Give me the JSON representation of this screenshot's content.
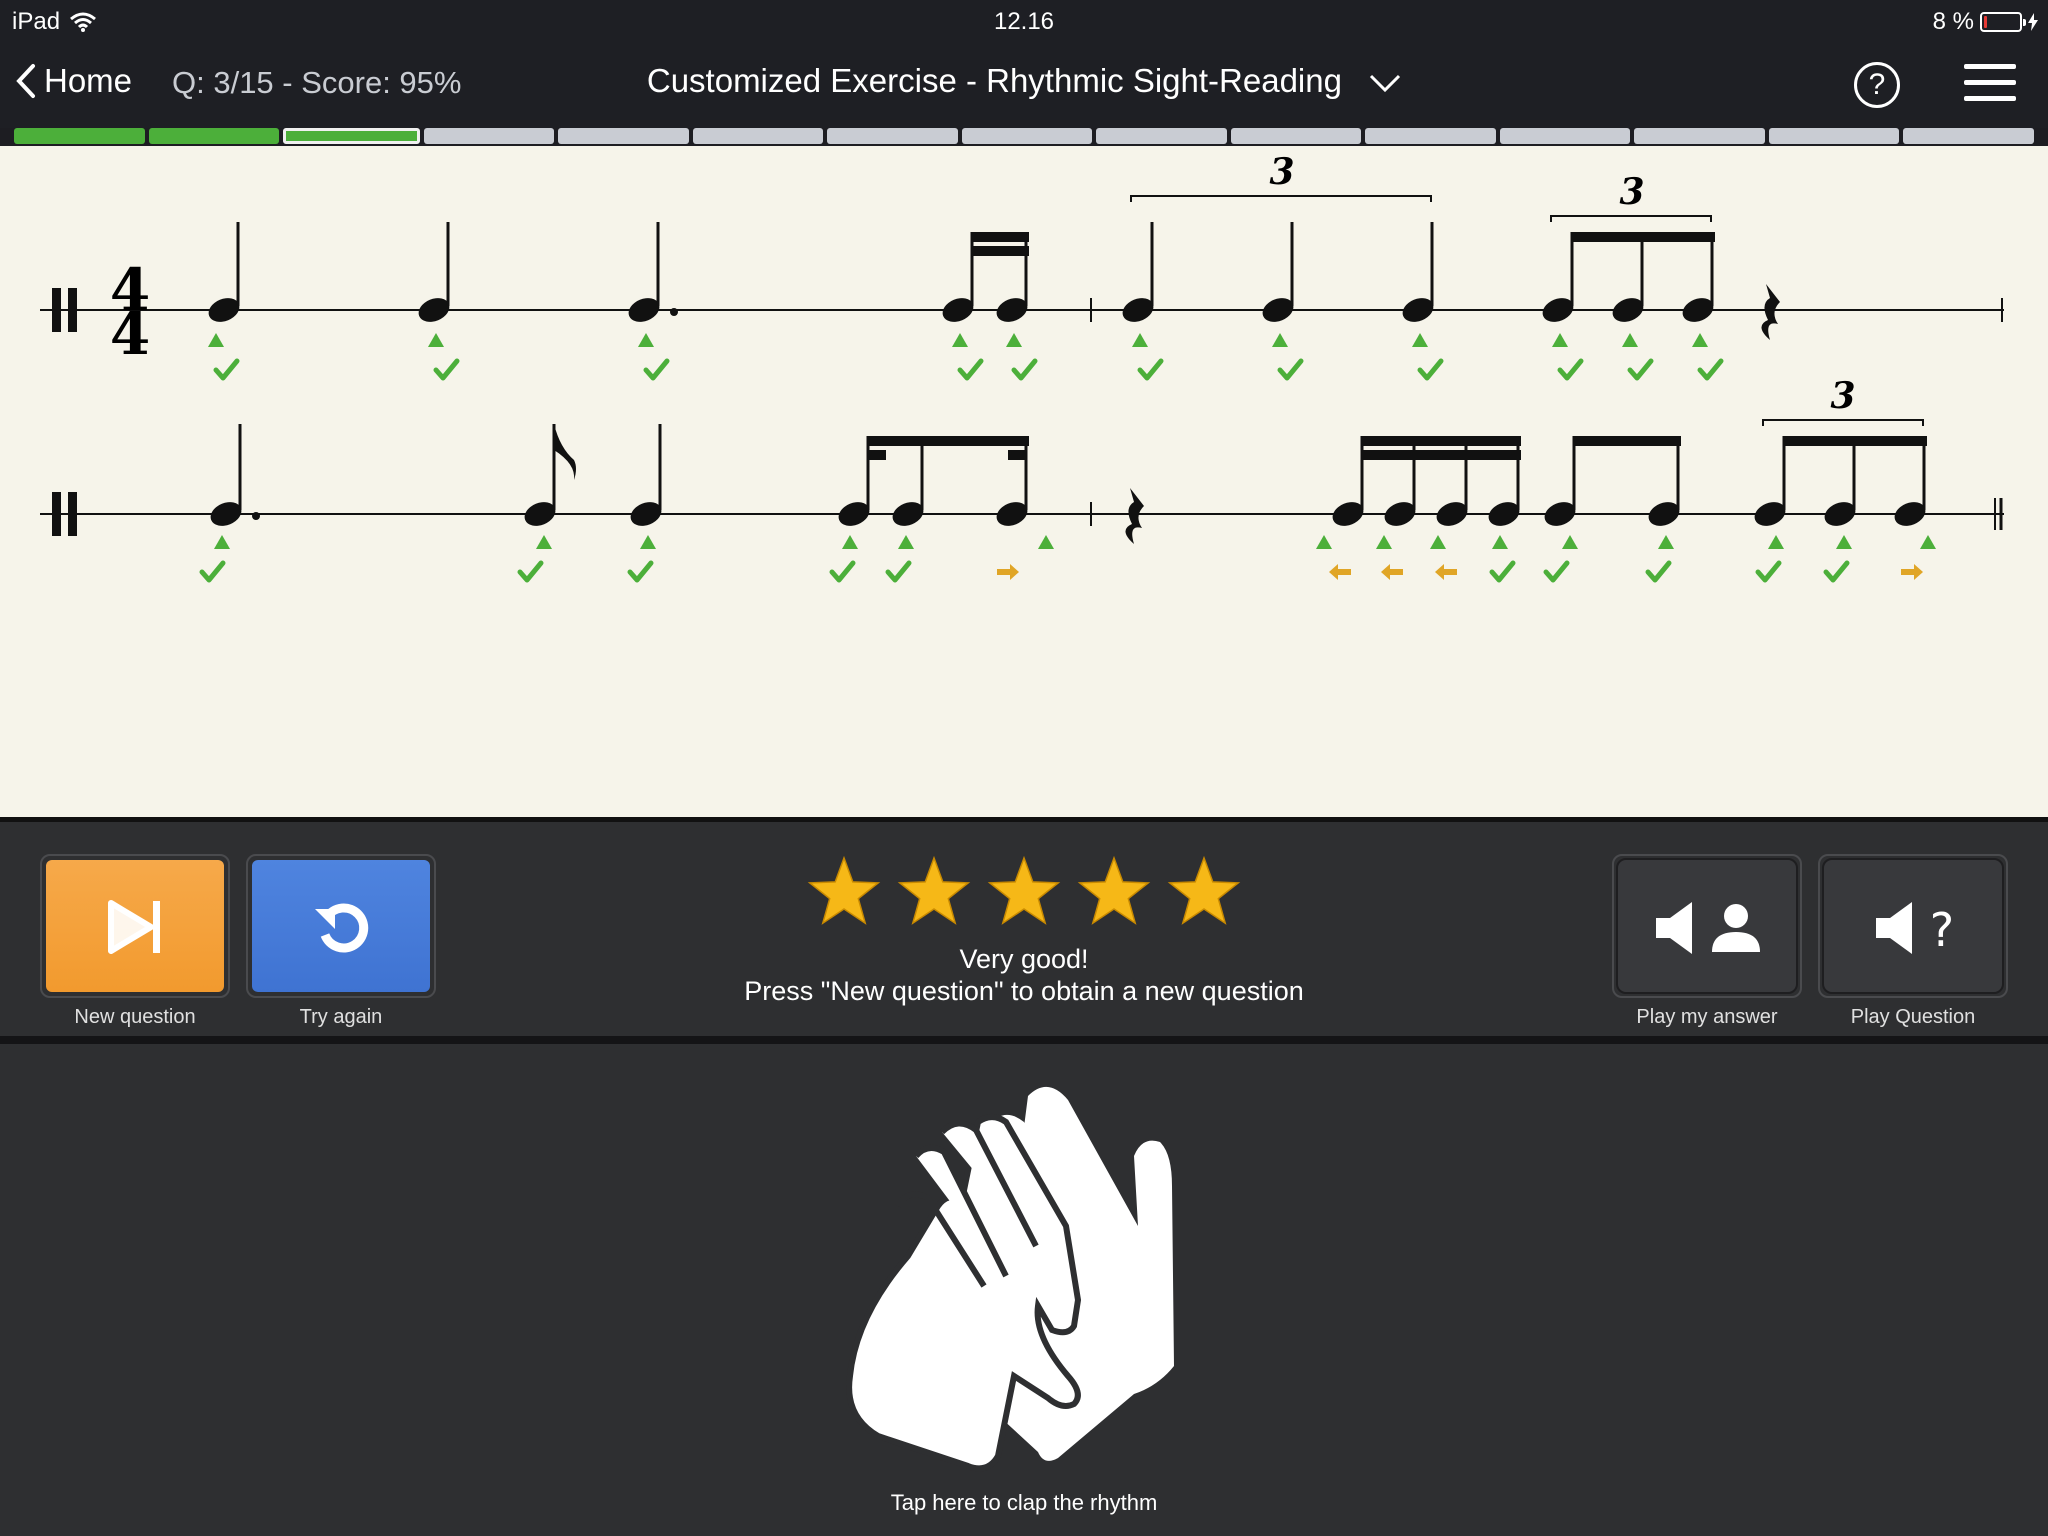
{
  "status": {
    "device": "iPad",
    "time": "12.16",
    "battery_text": "8 %",
    "battery_level": 0.08
  },
  "nav": {
    "back_label": "Home",
    "qscore": "Q: 3/15 - Score: 95%",
    "title": "Customized Exercise - Rhythmic Sight-Reading"
  },
  "progress": {
    "total": 15,
    "completed": 2,
    "current": 3
  },
  "score": {
    "time_signature_top": "4",
    "time_signature_bottom": "4",
    "tuplet_labels": [
      "3",
      "3",
      "3"
    ]
  },
  "controls": {
    "new_question_label": "New question",
    "try_again_label": "Try again",
    "play_answer_label": "Play my answer",
    "play_question_label": "Play Question",
    "rating": 5,
    "feedback_line1": "Very good!",
    "feedback_line2": "Press \"New question\" to obtain a new question"
  },
  "clap": {
    "label": "Tap here to clap the rhythm"
  },
  "colors": {
    "progress_done": "#4caf3a",
    "progress_pending": "#c9ccd3",
    "new_question_button": "#f29a2e",
    "try_again_button": "#3f73d2",
    "star": "#f6b817",
    "marker_correct": "#4caf3a",
    "marker_off": "#e0a526"
  }
}
